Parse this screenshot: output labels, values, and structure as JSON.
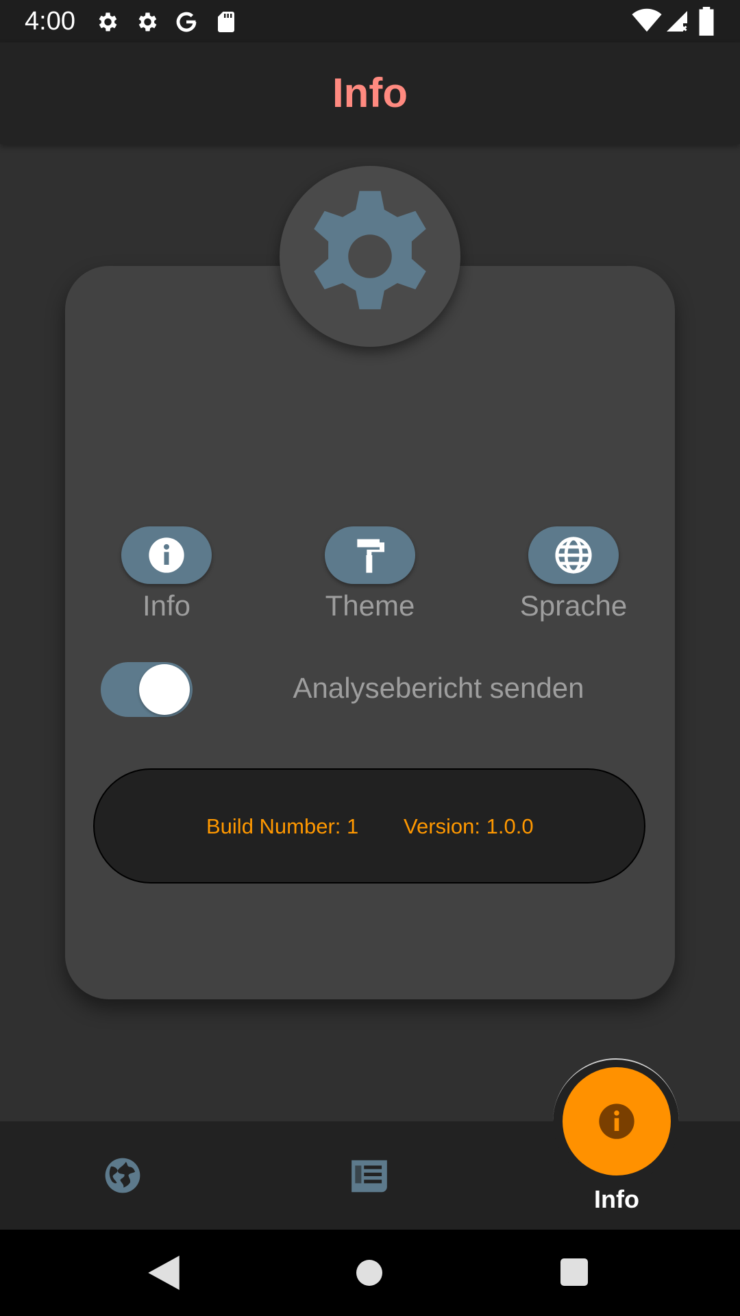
{
  "status_bar": {
    "time": "4:00",
    "left_icons": [
      "gear-icon",
      "gear-icon",
      "google-g-icon",
      "sd-card-icon"
    ],
    "right_icons": [
      "wifi-icon",
      "cell-signal-icon",
      "battery-icon"
    ]
  },
  "app_bar": {
    "title": "Info"
  },
  "card": {
    "avatar_icon": "gear-icon",
    "actions": [
      {
        "label": "Info",
        "icon": "info-icon"
      },
      {
        "label": "Theme",
        "icon": "paint-roller-icon"
      },
      {
        "label": "Sprache",
        "icon": "globe-icon"
      }
    ],
    "toggle": {
      "label": "Analysebericht senden",
      "on": true
    },
    "build_number": "Build Number: 1",
    "version": "Version: 1.0.0"
  },
  "bottom_nav": {
    "items": [
      {
        "icon": "earth-icon"
      },
      {
        "icon": "news-icon"
      },
      {
        "icon": "info-icon",
        "label": "Info",
        "active": true
      }
    ]
  },
  "colors": {
    "title": "#ff8a80",
    "accent": "#ff9100",
    "pill": "#5d7a8c",
    "build_text": "#ff9800"
  }
}
